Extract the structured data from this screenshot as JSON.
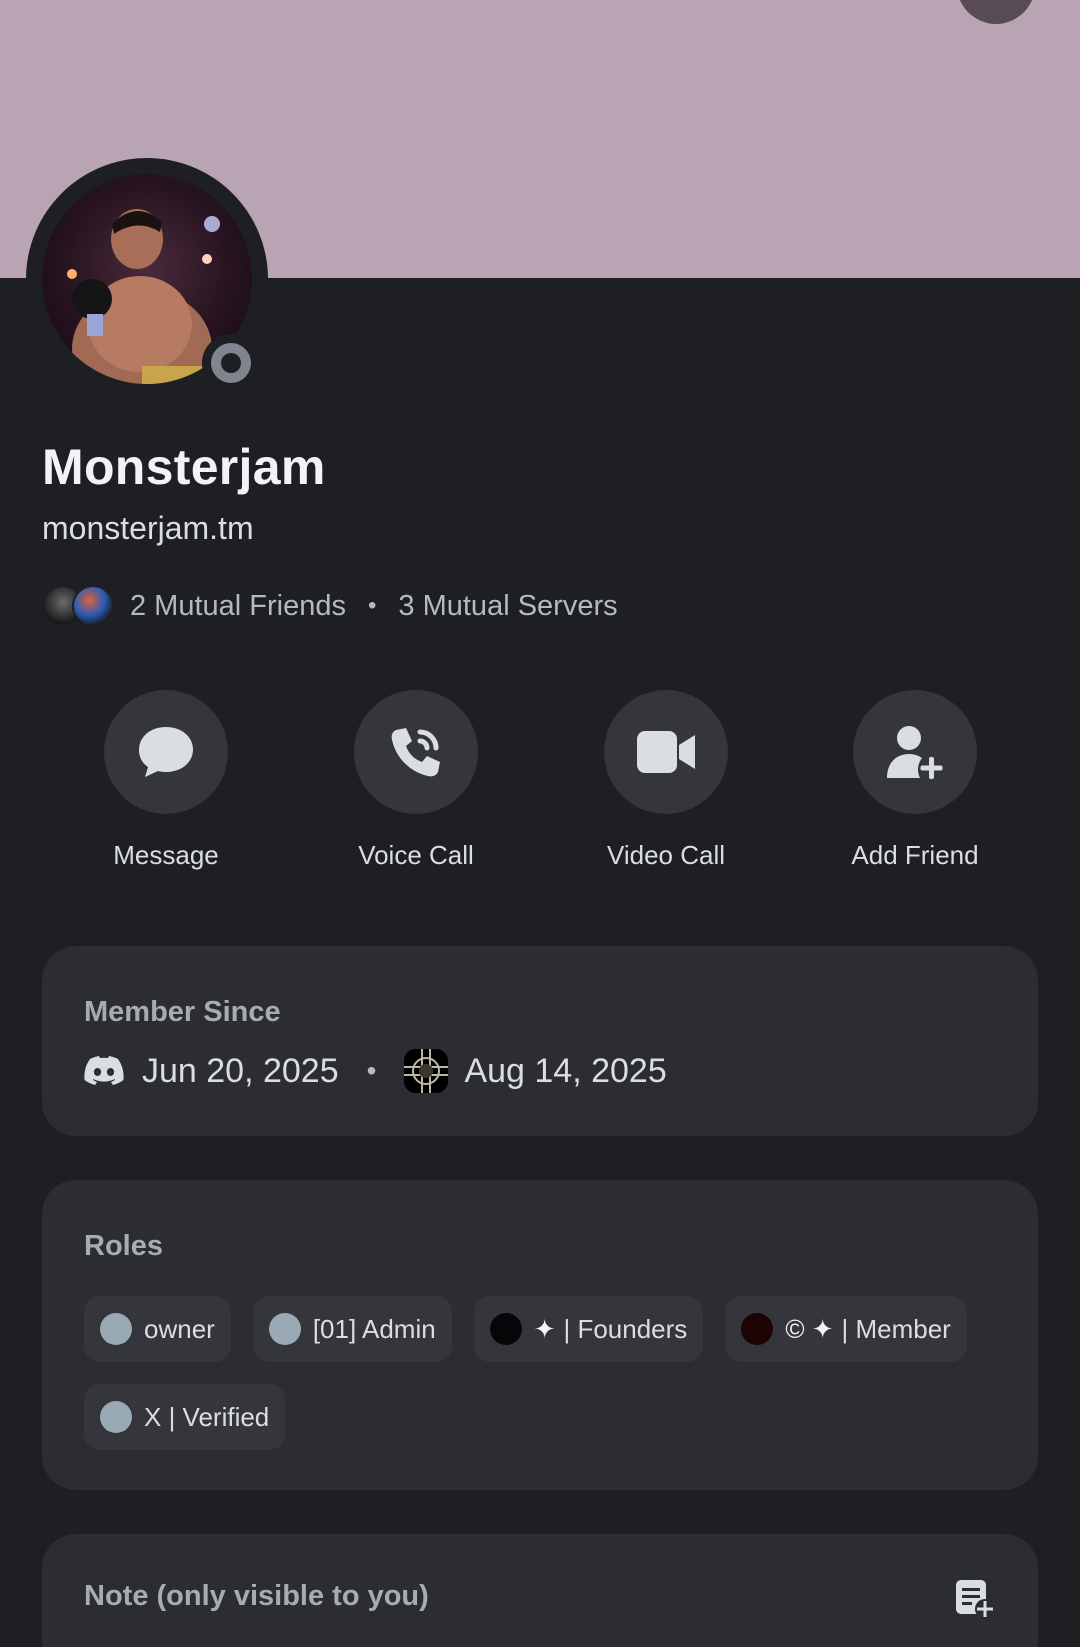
{
  "profile": {
    "display_name": "Monsterjam",
    "username": "monsterjam.tm",
    "status": "offline"
  },
  "mutuals": {
    "friends_label": "2 Mutual Friends",
    "separator": "•",
    "servers_label": "3 Mutual Servers"
  },
  "actions": [
    {
      "label": "Message",
      "icon": "chat-bubble-icon"
    },
    {
      "label": "Voice Call",
      "icon": "phone-icon"
    },
    {
      "label": "Video Call",
      "icon": "video-camera-icon"
    },
    {
      "label": "Add Friend",
      "icon": "add-friend-icon"
    }
  ],
  "member_since": {
    "title": "Member Since",
    "discord_date": "Jun 20, 2025",
    "separator": "•",
    "server_date": "Aug 14, 2025"
  },
  "roles": {
    "title": "Roles",
    "items": [
      {
        "label": "owner",
        "color": "#9aaab5",
        "glyphs": ""
      },
      {
        "label": "[01] Admin",
        "color": "#9aaab5",
        "glyphs": ""
      },
      {
        "label": "| Founders",
        "color": "#050608",
        "glyphs": "✦"
      },
      {
        "label": "| Member",
        "color": "#1c0404",
        "glyphs": "© ✦"
      },
      {
        "label": "X | Verified",
        "color": "#9aaab5",
        "glyphs": ""
      }
    ]
  },
  "note": {
    "placeholder": "Note (only visible to you)"
  },
  "colors": {
    "banner": "#b8a4b2",
    "background": "#1e1f22",
    "card": "#2b2d31",
    "action_button": "#35363c"
  }
}
